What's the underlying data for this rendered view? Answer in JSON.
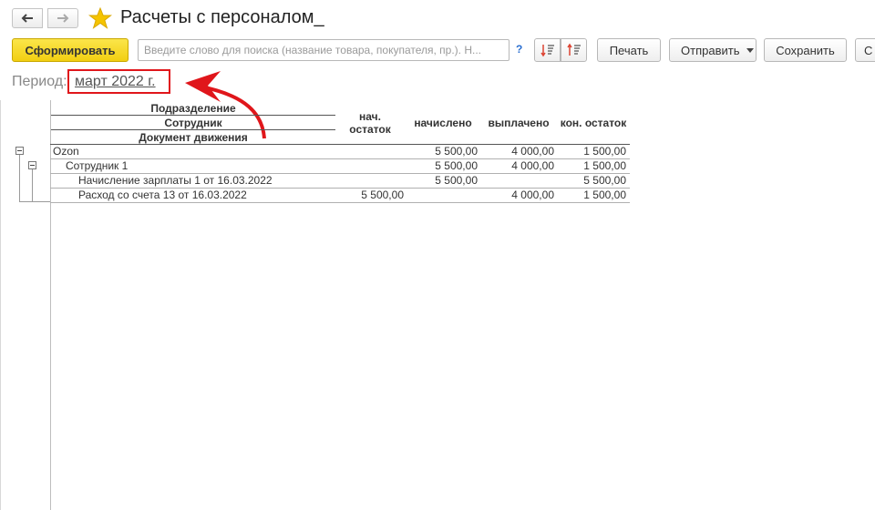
{
  "window": {
    "title": "Расчеты с персоналом_"
  },
  "nav": {
    "back_icon": "arrow-left-icon",
    "forward_icon": "arrow-right-icon",
    "favorite_icon": "star-icon"
  },
  "toolbar": {
    "generate_label": "Сформировать",
    "search_placeholder": "Введите слово для поиска (название товара, покупателя, пр.). Н...",
    "help_label": "?",
    "print_label": "Печать",
    "send_label": "Отправить",
    "save_label": "Сохранить",
    "extra_label": "С"
  },
  "period": {
    "label": "Период:",
    "value": "март 2022 г."
  },
  "annotation": {
    "color": "#e0161b"
  },
  "report": {
    "header": {
      "group1": "Подразделение",
      "group2": "Сотрудник",
      "group3": "Документ движения",
      "col_start": "нач. остаток",
      "col_accrued": "начислено",
      "col_paid": "выплачено",
      "col_end": "кон. остаток"
    },
    "rows": [
      {
        "name": "Ozon",
        "start": "",
        "accrued": "5 500,00",
        "paid": "4 000,00",
        "end": "1 500,00"
      },
      {
        "name": "Сотрудник 1",
        "start": "",
        "accrued": "5 500,00",
        "paid": "4 000,00",
        "end": "1 500,00"
      },
      {
        "name": "Начисление зарплаты 1 от 16.03.2022",
        "start": "",
        "accrued": "5 500,00",
        "paid": "",
        "end": "5 500,00"
      },
      {
        "name": "Расход со счета 13  от 16.03.2022",
        "start": "5 500,00",
        "accrued": "",
        "paid": "4 000,00",
        "end": "1 500,00"
      }
    ]
  }
}
